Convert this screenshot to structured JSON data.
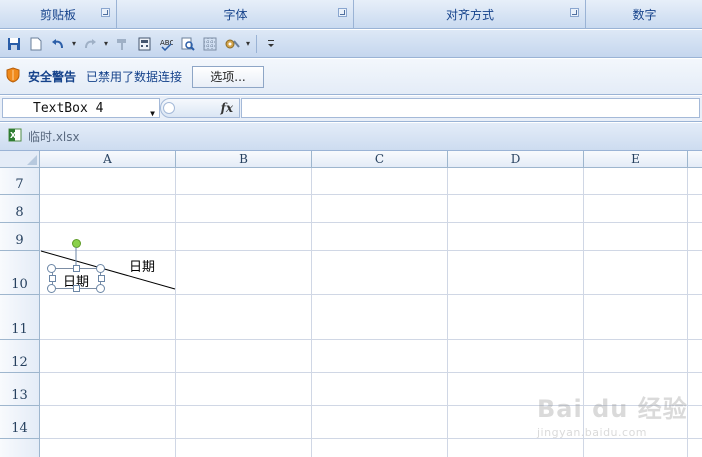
{
  "ribbon": {
    "groups": [
      {
        "label": "剪贴板"
      },
      {
        "label": "字体"
      },
      {
        "label": "对齐方式"
      },
      {
        "label": "数字"
      }
    ]
  },
  "quick_access": {
    "icons": [
      "save-icon",
      "new-document-icon",
      "undo-icon",
      "redo-icon",
      "format-painter-icon",
      "calculator-icon",
      "spelling-icon",
      "print-preview-icon",
      "borders-icon",
      "tools-icon",
      "customize-dropdown-icon"
    ]
  },
  "security_bar": {
    "title": "安全警告",
    "message": "已禁用了数据连接",
    "options_button": "选项..."
  },
  "formula_bar": {
    "name_box": "TextBox 4",
    "fx_label": "fx",
    "formula": ""
  },
  "workbook": {
    "filename": "临时.xlsx"
  },
  "sheet": {
    "columns": [
      "A",
      "B",
      "C",
      "D",
      "E"
    ],
    "rows": [
      "7",
      "8",
      "9",
      "10",
      "11",
      "12",
      "13",
      "14"
    ]
  },
  "cells": {
    "header_right_text": "日期",
    "textbox_text": "日期"
  },
  "watermark": {
    "brand": "Bai du 经验",
    "url": "jingyan.baidu.com"
  },
  "colors": {
    "ribbon_text": "#15428b",
    "grid_line": "#d0d7e5",
    "shield_orange": "#f08a1c",
    "rotation_handle": "#8ad14b"
  }
}
